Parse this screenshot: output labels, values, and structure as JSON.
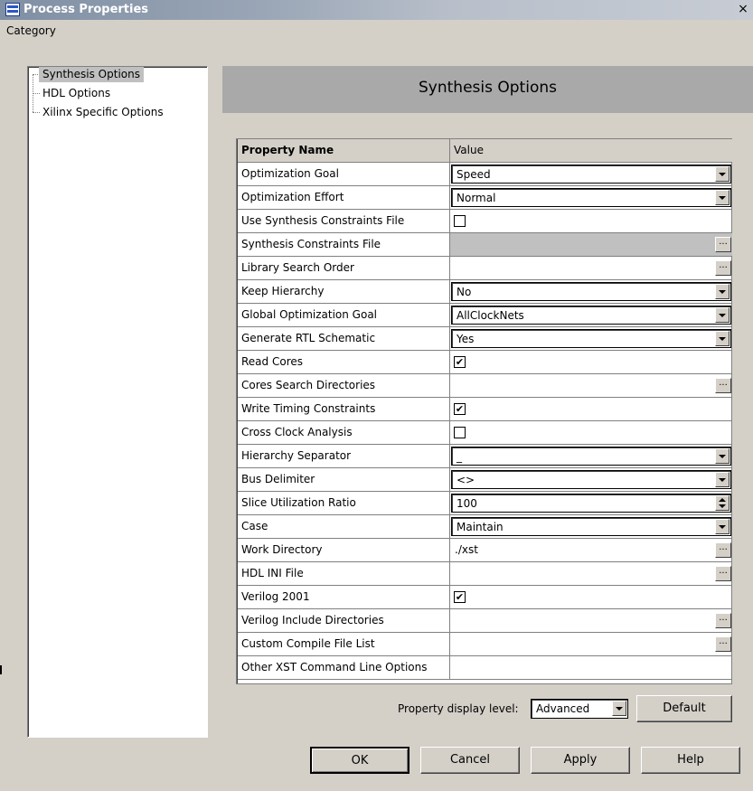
{
  "window": {
    "title": "Process Properties",
    "close_label": "×"
  },
  "category": {
    "label": "Category",
    "items": [
      {
        "label": "Synthesis Options",
        "selected": true
      },
      {
        "label": "HDL Options",
        "selected": false
      },
      {
        "label": "Xilinx Specific Options",
        "selected": false
      }
    ]
  },
  "section": {
    "title": "Synthesis Options"
  },
  "grid": {
    "columns": {
      "name": "Property Name",
      "value": "Value"
    },
    "rows": [
      {
        "name": "Optimization Goal",
        "type": "dropdown",
        "value": "Speed"
      },
      {
        "name": "Optimization Effort",
        "type": "dropdown",
        "value": "Normal"
      },
      {
        "name": "Use Synthesis Constraints File",
        "type": "checkbox",
        "checked": false,
        "value": ""
      },
      {
        "name": "Synthesis Constraints File",
        "type": "browse",
        "disabled": true,
        "value": ""
      },
      {
        "name": "Library Search Order",
        "type": "browse",
        "value": ""
      },
      {
        "name": "Keep Hierarchy",
        "type": "dropdown",
        "value": "No"
      },
      {
        "name": "Global Optimization Goal",
        "type": "dropdown",
        "value": "AllClockNets"
      },
      {
        "name": "Generate RTL Schematic",
        "type": "dropdown",
        "value": "Yes"
      },
      {
        "name": "Read Cores",
        "type": "checkbox",
        "checked": true,
        "value": ""
      },
      {
        "name": "Cores Search Directories",
        "type": "browse",
        "value": ""
      },
      {
        "name": "Write Timing Constraints",
        "type": "checkbox",
        "checked": true,
        "value": ""
      },
      {
        "name": "Cross Clock Analysis",
        "type": "checkbox",
        "checked": false,
        "value": ""
      },
      {
        "name": "Hierarchy Separator",
        "type": "dropdown",
        "value": "_"
      },
      {
        "name": "Bus Delimiter",
        "type": "dropdown",
        "value": "<>"
      },
      {
        "name": "Slice Utilization Ratio",
        "type": "spin",
        "value": "100"
      },
      {
        "name": "Case",
        "type": "dropdown",
        "value": "Maintain"
      },
      {
        "name": "Work Directory",
        "type": "browse",
        "value": "./xst"
      },
      {
        "name": "HDL INI File",
        "type": "browse",
        "value": ""
      },
      {
        "name": "Verilog 2001",
        "type": "checkbox",
        "checked": true,
        "value": ""
      },
      {
        "name": "Verilog Include Directories",
        "type": "browse",
        "value": ""
      },
      {
        "name": "Custom Compile File List",
        "type": "browse",
        "value": ""
      },
      {
        "name": "Other XST Command Line Options",
        "type": "text",
        "value": ""
      }
    ]
  },
  "footer": {
    "display_level_label": "Property display level:",
    "display_level_value": "Advanced",
    "default_label": "Default",
    "ok_label": "OK",
    "cancel_label": "Cancel",
    "apply_label": "Apply",
    "help_label": "Help"
  },
  "glyphs": {
    "check": "✔",
    "ellipsis": "..."
  }
}
